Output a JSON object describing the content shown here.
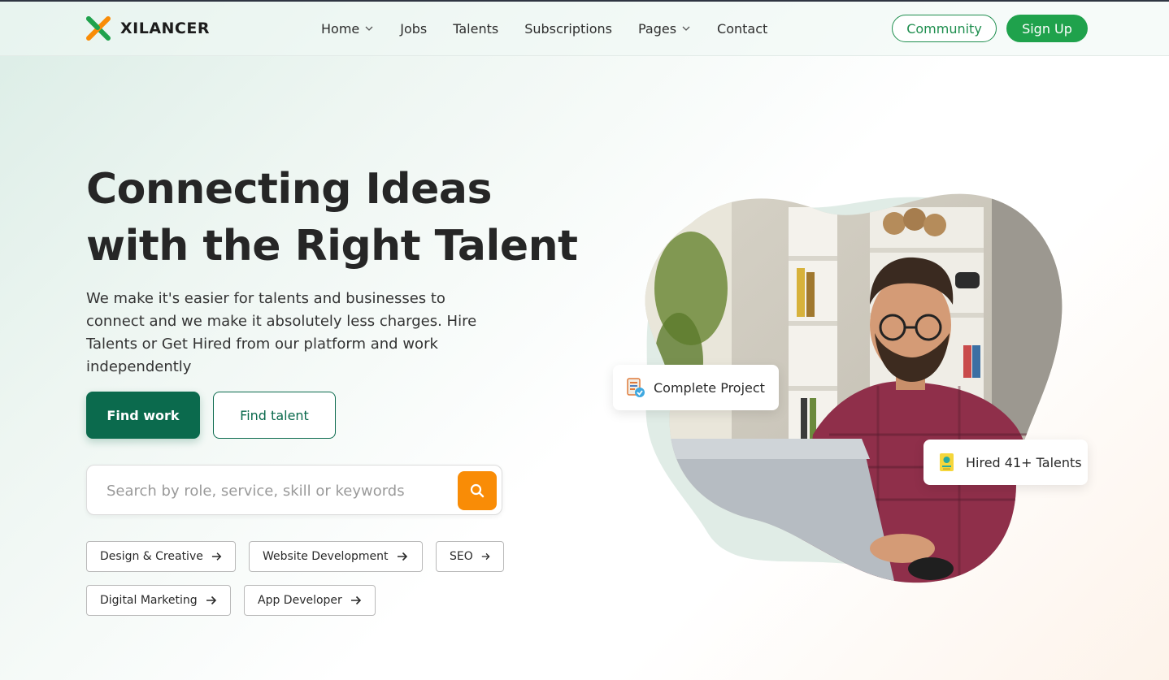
{
  "brand": {
    "name": "XILANCER",
    "accent_green": "#1fa24c",
    "accent_orange": "#f98c06",
    "dark_green": "#0b6a4d"
  },
  "nav": {
    "items": [
      {
        "label": "Home",
        "has_dropdown": true
      },
      {
        "label": "Jobs",
        "has_dropdown": false
      },
      {
        "label": "Talents",
        "has_dropdown": false
      },
      {
        "label": "Subscriptions",
        "has_dropdown": false
      },
      {
        "label": "Pages",
        "has_dropdown": true
      },
      {
        "label": "Contact",
        "has_dropdown": false
      }
    ],
    "community_label": "Community",
    "signup_label": "Sign Up"
  },
  "hero": {
    "title_line1": "Connecting Ideas",
    "title_line2": "with the Right Talent",
    "description": "We make it's easier for talents and businesses to connect and we make it absolutely less charges. Hire Talents or Get Hired from our platform and work independently",
    "find_work_label": "Find work",
    "find_talent_label": "Find talent"
  },
  "search": {
    "placeholder": "Search by role, service, skill or keywords",
    "value": "",
    "icon": "search-icon"
  },
  "tags": [
    {
      "label": "Design & Creative"
    },
    {
      "label": "Website Development"
    },
    {
      "label": "SEO"
    },
    {
      "label": "Digital Marketing"
    },
    {
      "label": "App Developer"
    }
  ],
  "cards": {
    "complete_project": "Complete Project",
    "hired_talents": "Hired 41+ Talents"
  }
}
